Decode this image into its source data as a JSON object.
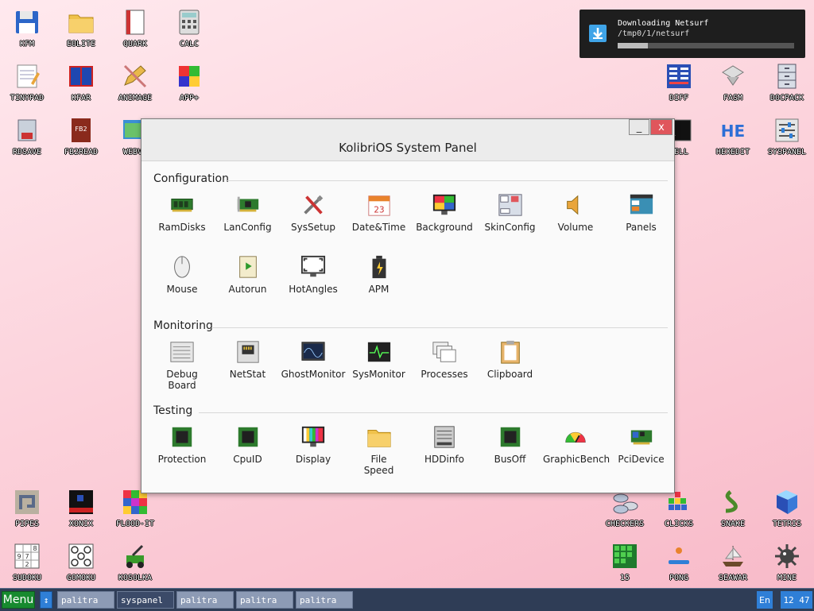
{
  "desktop": {
    "icons_left_top": [
      {
        "label": "KFM",
        "icon": "floppy-icon"
      },
      {
        "label": "EOLITE",
        "icon": "folder-icon"
      },
      {
        "label": "QUARK",
        "icon": "notebook-icon"
      },
      {
        "label": "CALC",
        "icon": "calculator-icon"
      },
      {
        "label": "TINYPAD",
        "icon": "notepad-icon"
      },
      {
        "label": "KFAR",
        "icon": "panels-icon"
      },
      {
        "label": "ANIMAGE",
        "icon": "pencil-icon"
      },
      {
        "label": "APP+",
        "icon": "cube-icon"
      },
      {
        "label": "RDSAVE",
        "icon": "save-icon"
      },
      {
        "label": "FB2READ",
        "icon": "book-icon"
      },
      {
        "label": "WEBVI",
        "icon": "web-icon"
      }
    ],
    "icons_right_top": [
      {
        "label": "DIFF",
        "icon": "diff-icon"
      },
      {
        "label": "FASM",
        "icon": "fasm-icon"
      },
      {
        "label": "DOCPACK",
        "icon": "cabinet-icon"
      },
      {
        "label": "HELL",
        "icon": "shell-icon"
      },
      {
        "label": "HEXEDIT",
        "icon": "hex-icon"
      },
      {
        "label": "SYSPANEL",
        "icon": "sliders-icon"
      }
    ],
    "icons_left_bottom": [
      {
        "label": "PIPES",
        "icon": "pipes-icon"
      },
      {
        "label": "XONIX",
        "icon": "xonix-icon"
      },
      {
        "label": "FLOOD-IT",
        "icon": "flood-icon"
      },
      {
        "label": "SUDOKU",
        "icon": "sudoku-icon"
      },
      {
        "label": "GOMOKU",
        "icon": "gomoku-icon"
      },
      {
        "label": "KOSOLKA",
        "icon": "mower-icon"
      }
    ],
    "icons_right_bottom": [
      {
        "label": "CHECKERS",
        "icon": "checkers-icon"
      },
      {
        "label": "CLICKS",
        "icon": "clicks-icon"
      },
      {
        "label": "SNAKE",
        "icon": "snake-icon"
      },
      {
        "label": "TETRIS",
        "icon": "tetris-icon"
      },
      {
        "label": "15",
        "icon": "fifteen-icon"
      },
      {
        "label": "PONG",
        "icon": "pong-icon"
      },
      {
        "label": "SEAWAR",
        "icon": "ship-icon"
      },
      {
        "label": "MINE",
        "icon": "mine-icon"
      }
    ]
  },
  "notification": {
    "title": "Downloading Netsurf",
    "path": "/tmp0/1/netsurf",
    "progress": 0.17
  },
  "window": {
    "title": "KolibriOS System Panel",
    "minimize": "_",
    "close": "x",
    "sections": [
      {
        "name": "Configuration",
        "items": [
          {
            "label": "RamDisks",
            "icon": "chip-green-icon"
          },
          {
            "label": "LanConfig",
            "icon": "network-card-icon"
          },
          {
            "label": "SysSetup",
            "icon": "tools-icon"
          },
          {
            "label": "Date&Time",
            "icon": "calendar-icon",
            "day": "23"
          },
          {
            "label": "Background",
            "icon": "monitor-colors-icon"
          },
          {
            "label": "SkinConfig",
            "icon": "skin-window-icon"
          },
          {
            "label": "Volume",
            "icon": "speaker-icon"
          },
          {
            "label": "Panels",
            "icon": "panels-window-icon"
          },
          {
            "label": "Mouse",
            "icon": "mouse-icon"
          },
          {
            "label": "Autorun",
            "icon": "scroll-play-icon"
          },
          {
            "label": "HotAngles",
            "icon": "monitor-corners-icon"
          },
          {
            "label": "APM",
            "icon": "battery-icon"
          }
        ]
      },
      {
        "name": "Monitoring",
        "items": [
          {
            "label": "Debug\nBoard",
            "icon": "debug-window-icon"
          },
          {
            "label": "NetStat",
            "icon": "network-port-icon"
          },
          {
            "label": "GhostMonitor",
            "icon": "oscilloscope-icon"
          },
          {
            "label": "SysMonitor",
            "icon": "pulse-monitor-icon"
          },
          {
            "label": "Processes",
            "icon": "windows-stack-icon"
          },
          {
            "label": "Clipboard",
            "icon": "clipboard-icon"
          }
        ]
      },
      {
        "name": "Testing",
        "items": [
          {
            "label": "Protection",
            "icon": "chip-icon"
          },
          {
            "label": "CpuID",
            "icon": "cpu-icon"
          },
          {
            "label": "Display",
            "icon": "color-bars-icon"
          },
          {
            "label": "File\nSpeed",
            "icon": "folder-icon"
          },
          {
            "label": "HDDinfo",
            "icon": "hdd-icon"
          },
          {
            "label": "BusOff",
            "icon": "chip-dark-icon"
          },
          {
            "label": "GraphicBench",
            "icon": "gauge-icon"
          },
          {
            "label": "PciDevice",
            "icon": "pci-card-icon"
          }
        ]
      }
    ]
  },
  "taskbar": {
    "menu": "Menu",
    "swap": "↕",
    "tasks": [
      "palitra",
      "syspanel",
      "palitra",
      "palitra",
      "palitra"
    ],
    "lang": "En",
    "clock": "12 47"
  },
  "colors": {
    "taskbar": "#2f3d56",
    "menu": "#178a2f",
    "accent": "#2f7fd7",
    "close": "#e0565c"
  }
}
